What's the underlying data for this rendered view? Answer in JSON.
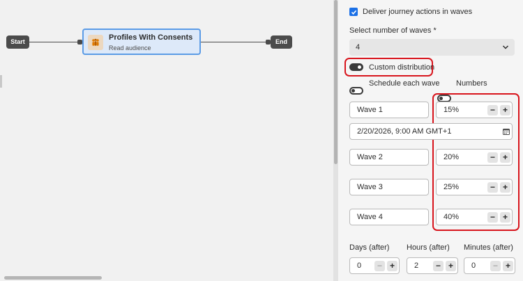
{
  "canvas": {
    "start_label": "Start",
    "end_label": "End",
    "activity": {
      "title": "Profiles With Consents",
      "subtitle": "Read audience",
      "icon": "audience-icon"
    }
  },
  "panel": {
    "deliver_waves_label": "Deliver journey actions in waves",
    "deliver_waves_checked": true,
    "select_waves_label": "Select number of waves *",
    "waves_count": "4",
    "custom_distribution_label": "Custom distribution",
    "custom_distribution_on": true,
    "schedule_each_wave_label": "Schedule each wave",
    "schedule_each_wave_on": false,
    "numbers_label": "Numbers",
    "numbers_on": false,
    "waves": [
      {
        "name": "Wave 1",
        "percent": "15%"
      },
      {
        "name": "Wave 2",
        "percent": "20%"
      },
      {
        "name": "Wave 3",
        "percent": "25%"
      },
      {
        "name": "Wave 4",
        "percent": "40%"
      }
    ],
    "wave1_datetime": "2/20/2026, 9:00 AM GMT+1",
    "days_label": "Days (after)",
    "days_value": "0",
    "hours_label": "Hours (after)",
    "hours_value": "2",
    "minutes_label": "Minutes (after)",
    "minutes_value": "0",
    "minus_glyph": "−",
    "plus_glyph": "+"
  },
  "colors": {
    "accent": "#1b70e6",
    "highlight": "#d8141c",
    "node_fill": "#dde9f9",
    "node_border": "#5b9be6"
  }
}
